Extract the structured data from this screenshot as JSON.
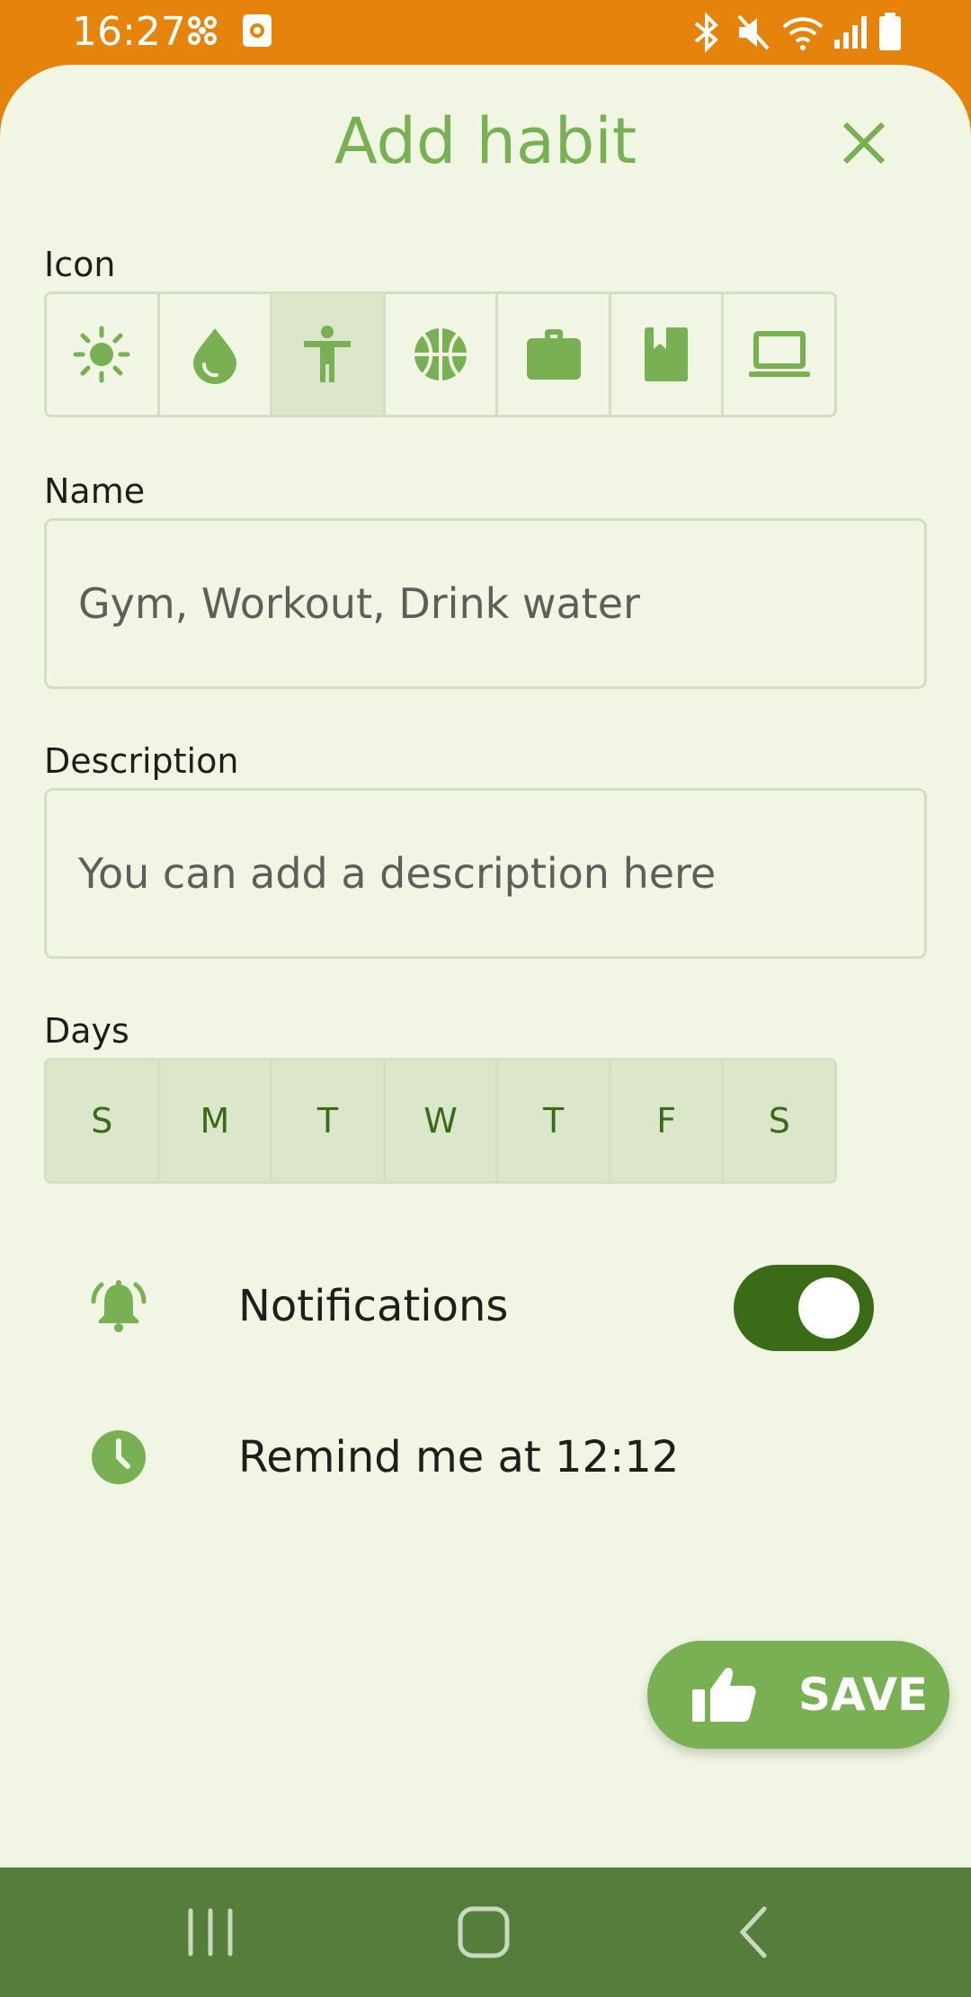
{
  "status_bar": {
    "time": "16:27",
    "left_icons": [
      "fan-icon",
      "media-icon"
    ],
    "right_icons": [
      "bluetooth-icon",
      "mute-icon",
      "wifi-icon",
      "signal-icon",
      "battery-icon"
    ]
  },
  "header": {
    "title": "Add habit",
    "close_icon": "close-icon"
  },
  "icon_section": {
    "label": "Icon",
    "options": [
      "sun-icon",
      "water-drop-icon",
      "person-icon",
      "basketball-icon",
      "briefcase-icon",
      "book-icon",
      "laptop-icon"
    ],
    "selected_index": 2
  },
  "name": {
    "label": "Name",
    "placeholder": "Gym, Workout, Drink water",
    "value": ""
  },
  "description": {
    "label": "Description",
    "placeholder": "You can add a description here",
    "value": ""
  },
  "days": {
    "label": "Days",
    "items": [
      "S",
      "M",
      "T",
      "W",
      "T",
      "F",
      "S"
    ]
  },
  "notifications": {
    "label": "Notifications",
    "icon": "bell-ring-icon",
    "enabled": true
  },
  "reminder": {
    "label": "Remind me at 12:12",
    "icon": "clock-icon"
  },
  "save_button": {
    "label": "SAVE",
    "icon": "thumbs-up-icon"
  },
  "nav_bar": {
    "buttons": [
      "recents-icon",
      "home-icon",
      "back-icon"
    ]
  },
  "colors": {
    "status_bar": "#e6830a",
    "background": "#f0f6e3",
    "accent": "#78b053",
    "accent_dark": "#3c6b18",
    "selected_bg": "#dbe6cb",
    "nav_bar": "#557e3c"
  }
}
